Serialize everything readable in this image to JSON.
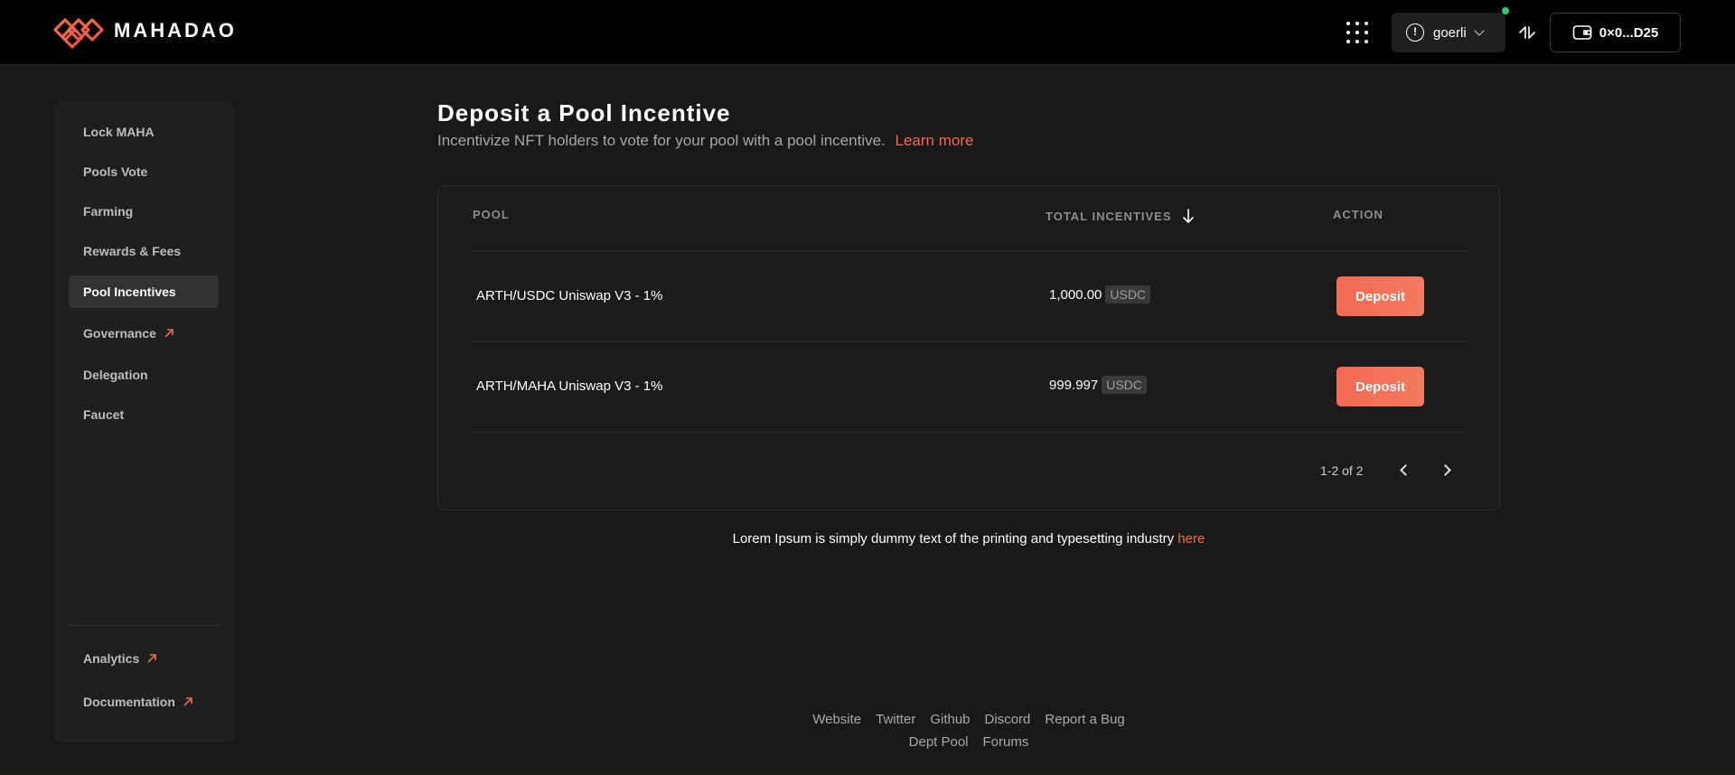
{
  "brand": {
    "name": "MAHADAO"
  },
  "header": {
    "network_label": "goerli",
    "network_status_color": "#2ecc71",
    "wallet_label": "0×0...D25",
    "icons": [
      "apps-grid-icon",
      "alert-circle-icon",
      "chevron-down-icon",
      "swap-arrows-icon",
      "wallet-icon"
    ]
  },
  "sidebar": {
    "items": [
      {
        "label": "Lock MAHA",
        "external": false,
        "active": false
      },
      {
        "label": "Pools Vote",
        "external": false,
        "active": false
      },
      {
        "label": "Farming",
        "external": false,
        "active": false
      },
      {
        "label": "Rewards & Fees",
        "external": false,
        "active": false
      },
      {
        "label": "Pool Incentives",
        "external": false,
        "active": true
      },
      {
        "label": "Governance",
        "external": true,
        "active": false
      },
      {
        "label": "Delegation",
        "external": false,
        "active": false
      },
      {
        "label": "Faucet",
        "external": false,
        "active": false
      }
    ],
    "bottom_items": [
      {
        "label": "Analytics",
        "external": true
      },
      {
        "label": "Documentation",
        "external": true
      }
    ]
  },
  "main": {
    "title": "Deposit a Pool Incentive",
    "subtitle": "Incentivize NFT holders to vote for your pool with a pool incentive.",
    "learn_more": "Learn more",
    "accent_color": "#ef6a52"
  },
  "table": {
    "columns": [
      "POOL",
      "TOTAL INCENTIVES",
      "ACTION"
    ],
    "sort": "descending",
    "rows": [
      {
        "pool": "ARTH/USDC Uniswap V3 - 1%",
        "amount": "1,000.00",
        "token": "USDC",
        "action": "Deposit"
      },
      {
        "pool": "ARTH/MAHA Uniswap V3 - 1%",
        "amount": "999.997",
        "token": "USDC",
        "action": "Deposit"
      }
    ],
    "pagination": "1-2 of 2"
  },
  "note": {
    "text": "Lorem Ipsum is simply dummy text of the printing and typesetting industry",
    "link": "here"
  },
  "footer": {
    "row1": [
      "Website",
      "Twitter",
      "Github",
      "Discord",
      "Report a Bug"
    ],
    "row2": [
      "Dept Pool",
      "Forums"
    ]
  }
}
